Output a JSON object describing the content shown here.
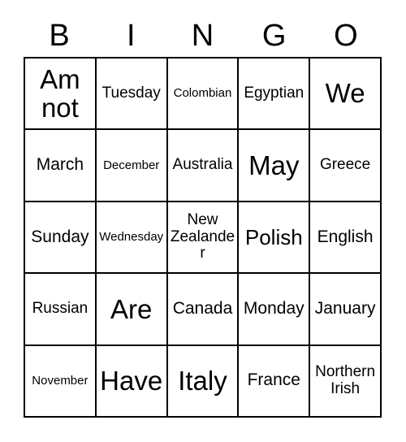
{
  "header": {
    "letters": [
      "B",
      "I",
      "N",
      "G",
      "O"
    ]
  },
  "grid": {
    "rows": [
      [
        {
          "text": "Am not",
          "size": "fs-xl"
        },
        {
          "text": "Tuesday",
          "size": "fs-sm"
        },
        {
          "text": "Colombian",
          "size": "fs-xs"
        },
        {
          "text": "Egyptian",
          "size": "fs-sm"
        },
        {
          "text": "We",
          "size": "fs-xl"
        }
      ],
      [
        {
          "text": "March",
          "size": "fs-md"
        },
        {
          "text": "December",
          "size": "fs-xs"
        },
        {
          "text": "Australia",
          "size": "fs-sm"
        },
        {
          "text": "May",
          "size": "fs-xl"
        },
        {
          "text": "Greece",
          "size": "fs-sm"
        }
      ],
      [
        {
          "text": "Sunday",
          "size": "fs-md"
        },
        {
          "text": "Wednesday",
          "size": "fs-xs"
        },
        {
          "text": "New Zealander",
          "size": "fs-sm"
        },
        {
          "text": "Polish",
          "size": "fs-lg"
        },
        {
          "text": "English",
          "size": "fs-md"
        }
      ],
      [
        {
          "text": "Russian",
          "size": "fs-sm"
        },
        {
          "text": "Are",
          "size": "fs-xl"
        },
        {
          "text": "Canada",
          "size": "fs-md"
        },
        {
          "text": "Monday",
          "size": "fs-md"
        },
        {
          "text": "January",
          "size": "fs-md"
        }
      ],
      [
        {
          "text": "November",
          "size": "fs-xs"
        },
        {
          "text": "Have",
          "size": "fs-xl"
        },
        {
          "text": "Italy",
          "size": "fs-xl"
        },
        {
          "text": "France",
          "size": "fs-md"
        },
        {
          "text": "Northern Irish",
          "size": "fs-sm"
        }
      ]
    ]
  },
  "colors": {
    "background": "#ffffff",
    "border": "#000000",
    "text": "#000000"
  }
}
